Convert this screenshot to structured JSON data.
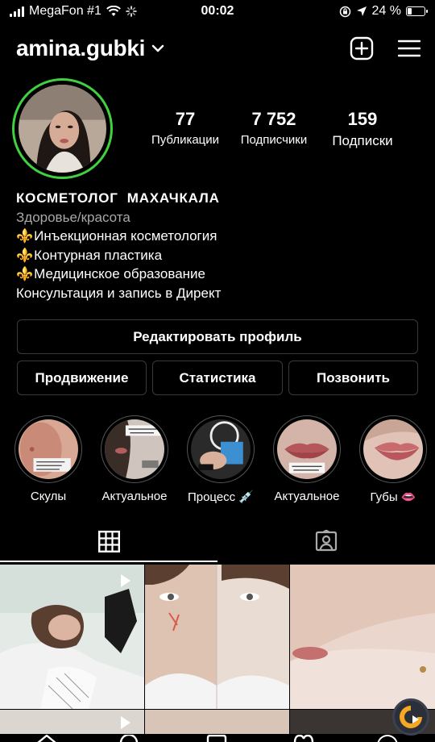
{
  "status_bar": {
    "carrier": "MegaFon #1",
    "time": "00:02",
    "battery_pct": "24 %",
    "battery_level": 0.24
  },
  "header": {
    "username": "amina.gubki",
    "icons": [
      "chevron-down-icon",
      "new-post-icon",
      "menu-icon"
    ]
  },
  "profile": {
    "stats": [
      {
        "num": "77",
        "label": "Публикации"
      },
      {
        "num": "7 752",
        "label": "Подписчики"
      },
      {
        "num": "159",
        "label": "Подписки"
      }
    ],
    "name": "КОСМЕТОЛОГ  МАХАЧКАЛА",
    "category": "Здоровье/красота",
    "bio_lines": [
      "Инъекционная косметология",
      "Контурная пластика",
      "Медицинское образование"
    ],
    "bio_cta": "Консультация и запись в Директ",
    "bio_emoji": "⚜️"
  },
  "buttons": {
    "edit": "Редактировать профиль",
    "promo": "Продвижение",
    "stats": "Статистика",
    "call": "Позвонить"
  },
  "highlights": [
    {
      "label": "Скулы"
    },
    {
      "label": "Актуальное"
    },
    {
      "label": "Процесс 💉"
    },
    {
      "label": "Актуальное"
    },
    {
      "label": "Губы 👄"
    }
  ],
  "tabs": [
    "grid-icon",
    "tagged-icon"
  ],
  "colors": {
    "story_ring": "#3fd13f",
    "background": "#000000",
    "button_border": "#3a3a3a",
    "category_text": "#a8a8a8",
    "fab": "#f5a623"
  }
}
